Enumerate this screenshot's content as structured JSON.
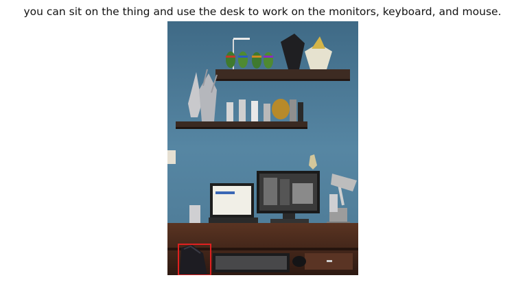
{
  "caption": "you can sit on the thing and use the desk to work on the monitors, keyboard, and mouse.",
  "photo": {
    "subjects": [
      "shelves-with-figurines",
      "desk",
      "laptop",
      "monitor",
      "keyboard",
      "mouse",
      "desk-lamp",
      "speakers",
      "chair"
    ],
    "highlight": {
      "target": "chair",
      "color": "#e02020"
    },
    "colors": {
      "wall": "#4f7c99",
      "desk": "#4a2a1c",
      "shelf": "#3d2b22"
    }
  }
}
